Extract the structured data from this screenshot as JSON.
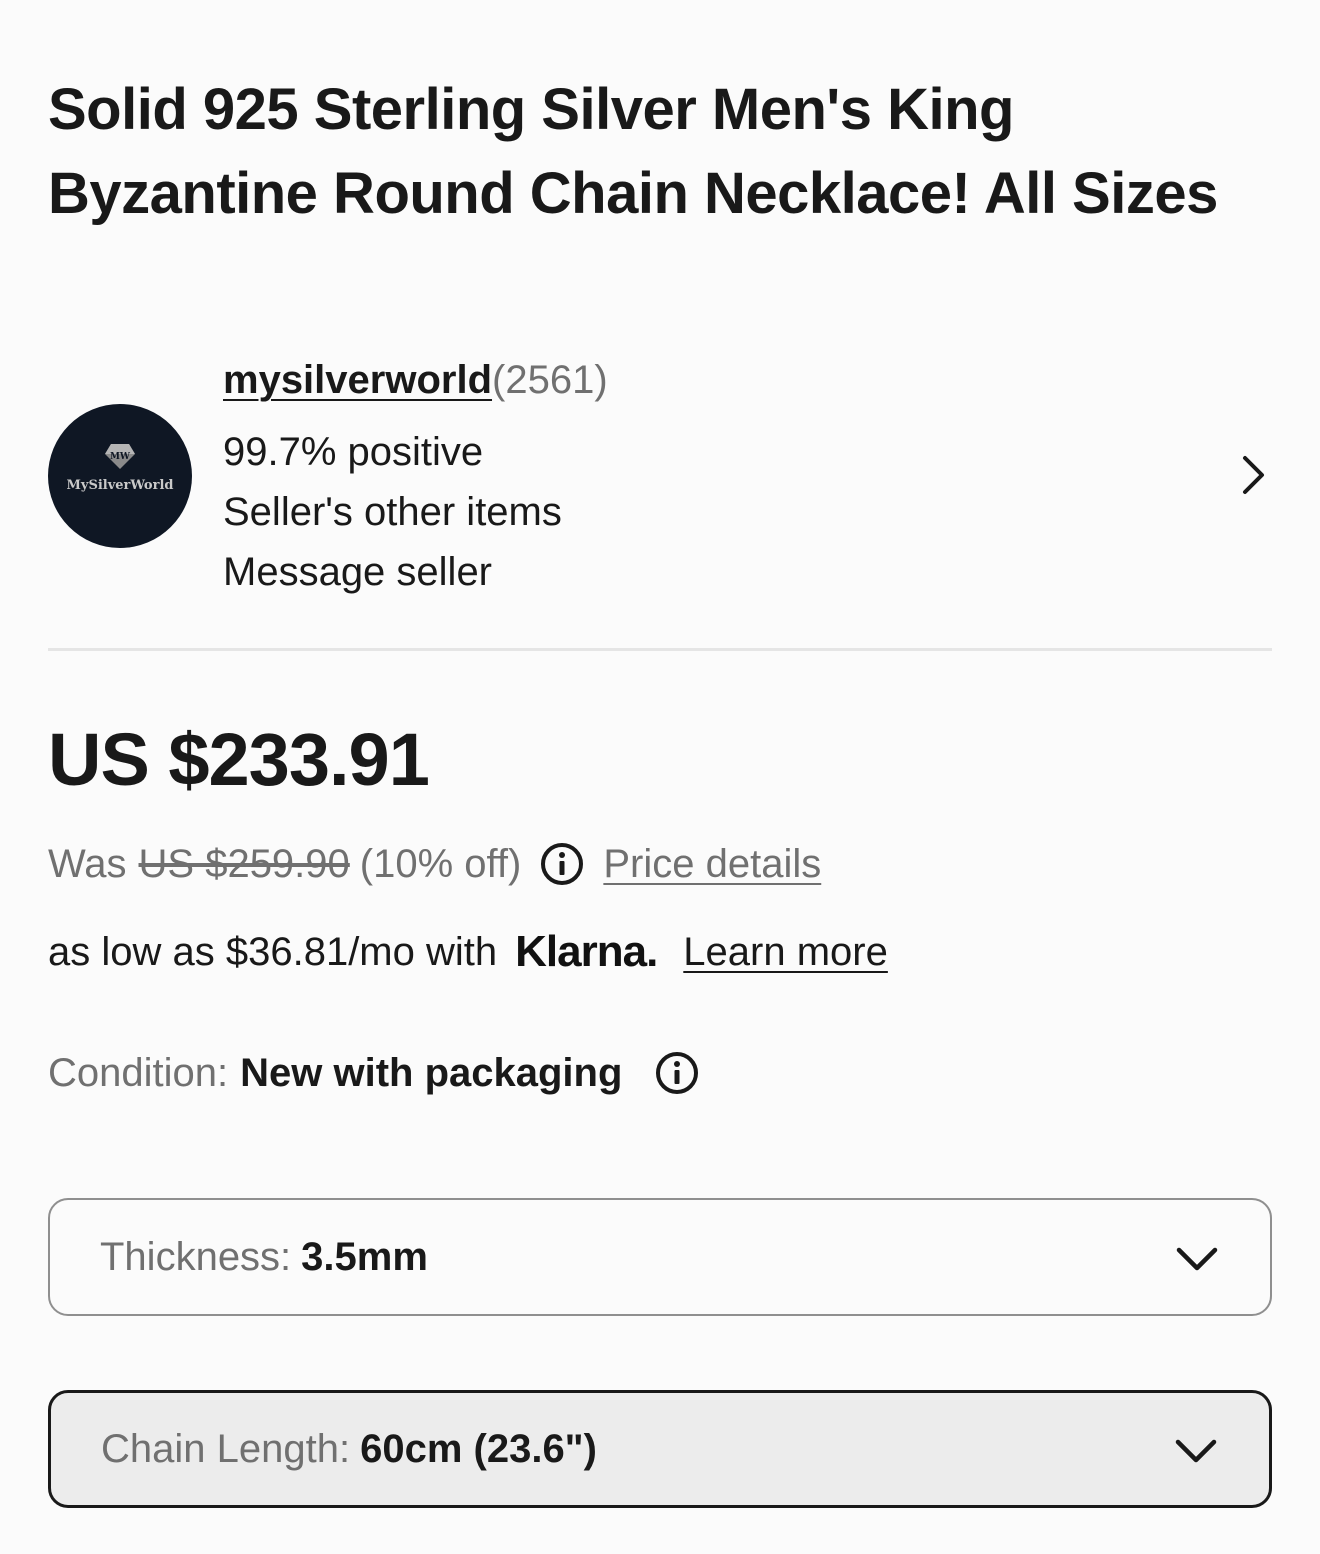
{
  "listing": {
    "title": "Solid 925 Sterling Silver Men's King Byzantine Round Chain Necklace! All Sizes"
  },
  "seller": {
    "name": "mysilverworld",
    "feedback_count": "(2561)",
    "positive": "99.7% positive",
    "other_items_label": "Seller's other items",
    "message_label": "Message seller",
    "avatar_text": "MySilverWorld"
  },
  "price": {
    "current": "US $233.91",
    "was_label": "Was",
    "was_price": "US $259.90",
    "discount": "(10% off)",
    "details_link": "Price details"
  },
  "financing": {
    "text": "as low as $36.81/mo with",
    "provider": "Klarna.",
    "learn_more": "Learn more"
  },
  "condition": {
    "label": "Condition:",
    "value": "New with packaging"
  },
  "variations": [
    {
      "label": "Thickness:",
      "value": "3.5mm"
    },
    {
      "label": "Chain Length:",
      "value": "60cm (23.6\")"
    }
  ],
  "icons": {
    "info": "info-circle-icon",
    "chevron_right": "chevron-right-icon",
    "chevron_down": "chevron-down-icon"
  },
  "colors": {
    "text": "#191919",
    "muted": "#707070",
    "divider": "#e5e5e5",
    "avatar_bg": "#0f1724",
    "active_select_bg": "#ececec"
  }
}
